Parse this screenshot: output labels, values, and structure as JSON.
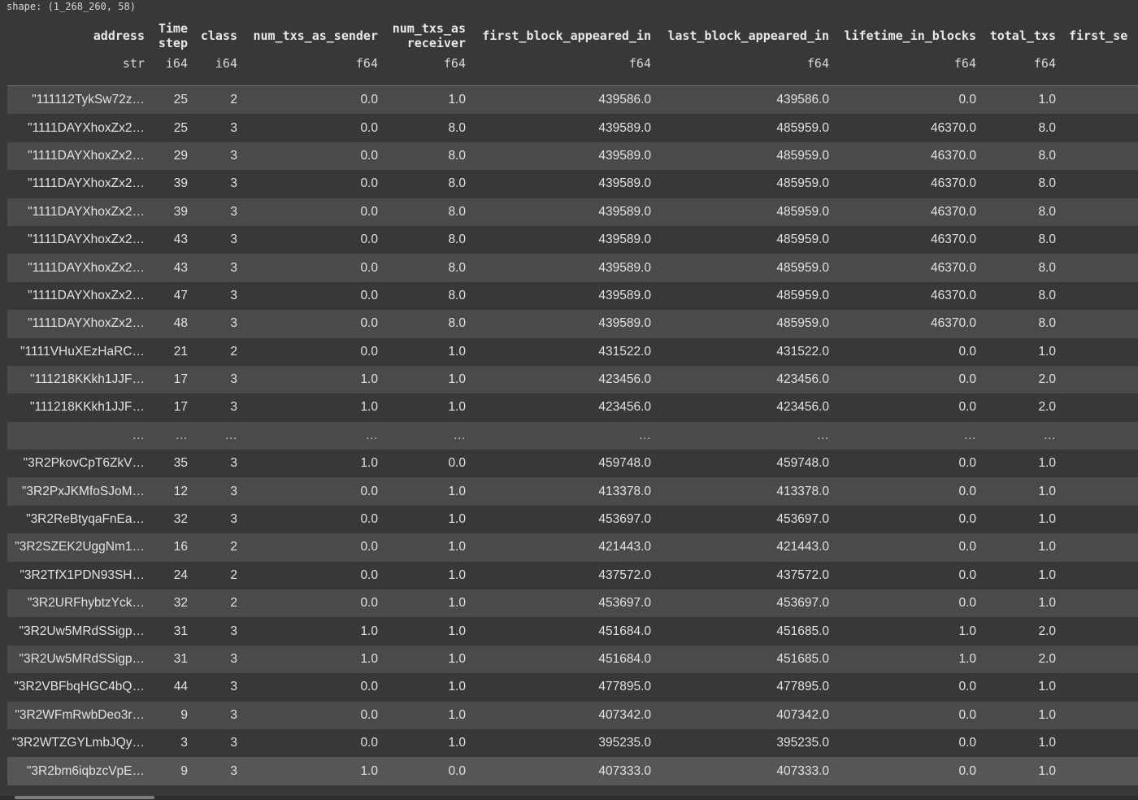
{
  "shape_label": "shape: (1_268_260, 58)",
  "columns": [
    {
      "name": "address",
      "dtype": "str"
    },
    {
      "name": "Time\nstep",
      "dtype": "i64"
    },
    {
      "name": "class",
      "dtype": "i64"
    },
    {
      "name": "num_txs_as_sender",
      "dtype": "f64"
    },
    {
      "name": "num_txs_as\nreceiver",
      "dtype": "f64"
    },
    {
      "name": "first_block_appeared_in",
      "dtype": "f64"
    },
    {
      "name": "last_block_appeared_in",
      "dtype": "f64"
    },
    {
      "name": "lifetime_in_blocks",
      "dtype": "f64"
    },
    {
      "name": "total_txs",
      "dtype": "f64"
    },
    {
      "name": "first_se",
      "dtype": ""
    }
  ],
  "rows": [
    [
      "\"111112TykSw72z…",
      "25",
      "2",
      "0.0",
      "1.0",
      "439586.0",
      "439586.0",
      "0.0",
      "1.0",
      ""
    ],
    [
      "\"1111DAYXhoxZx2…",
      "25",
      "3",
      "0.0",
      "8.0",
      "439589.0",
      "485959.0",
      "46370.0",
      "8.0",
      ""
    ],
    [
      "\"1111DAYXhoxZx2…",
      "29",
      "3",
      "0.0",
      "8.0",
      "439589.0",
      "485959.0",
      "46370.0",
      "8.0",
      ""
    ],
    [
      "\"1111DAYXhoxZx2…",
      "39",
      "3",
      "0.0",
      "8.0",
      "439589.0",
      "485959.0",
      "46370.0",
      "8.0",
      ""
    ],
    [
      "\"1111DAYXhoxZx2…",
      "39",
      "3",
      "0.0",
      "8.0",
      "439589.0",
      "485959.0",
      "46370.0",
      "8.0",
      ""
    ],
    [
      "\"1111DAYXhoxZx2…",
      "43",
      "3",
      "0.0",
      "8.0",
      "439589.0",
      "485959.0",
      "46370.0",
      "8.0",
      ""
    ],
    [
      "\"1111DAYXhoxZx2…",
      "43",
      "3",
      "0.0",
      "8.0",
      "439589.0",
      "485959.0",
      "46370.0",
      "8.0",
      ""
    ],
    [
      "\"1111DAYXhoxZx2…",
      "47",
      "3",
      "0.0",
      "8.0",
      "439589.0",
      "485959.0",
      "46370.0",
      "8.0",
      ""
    ],
    [
      "\"1111DAYXhoxZx2…",
      "48",
      "3",
      "0.0",
      "8.0",
      "439589.0",
      "485959.0",
      "46370.0",
      "8.0",
      ""
    ],
    [
      "\"1111VHuXEzHaRC…",
      "21",
      "2",
      "0.0",
      "1.0",
      "431522.0",
      "431522.0",
      "0.0",
      "1.0",
      ""
    ],
    [
      "\"111218KKkh1JJF…",
      "17",
      "3",
      "1.0",
      "1.0",
      "423456.0",
      "423456.0",
      "0.0",
      "2.0",
      ""
    ],
    [
      "\"111218KKkh1JJF…",
      "17",
      "3",
      "1.0",
      "1.0",
      "423456.0",
      "423456.0",
      "0.0",
      "2.0",
      ""
    ],
    [
      "…",
      "…",
      "…",
      "…",
      "…",
      "…",
      "…",
      "…",
      "…",
      ""
    ],
    [
      "\"3R2PkovCpT6ZkV…",
      "35",
      "3",
      "1.0",
      "0.0",
      "459748.0",
      "459748.0",
      "0.0",
      "1.0",
      ""
    ],
    [
      "\"3R2PxJKMfoSJoM…",
      "12",
      "3",
      "0.0",
      "1.0",
      "413378.0",
      "413378.0",
      "0.0",
      "1.0",
      ""
    ],
    [
      "\"3R2ReBtyqaFnEa…",
      "32",
      "3",
      "0.0",
      "1.0",
      "453697.0",
      "453697.0",
      "0.0",
      "1.0",
      ""
    ],
    [
      "\"3R2SZEK2UggNm1…",
      "16",
      "2",
      "0.0",
      "1.0",
      "421443.0",
      "421443.0",
      "0.0",
      "1.0",
      ""
    ],
    [
      "\"3R2TfX1PDN93SH…",
      "24",
      "2",
      "0.0",
      "1.0",
      "437572.0",
      "437572.0",
      "0.0",
      "1.0",
      ""
    ],
    [
      "\"3R2URFhybtzYck…",
      "32",
      "2",
      "0.0",
      "1.0",
      "453697.0",
      "453697.0",
      "0.0",
      "1.0",
      ""
    ],
    [
      "\"3R2Uw5MRdSSigp…",
      "31",
      "3",
      "1.0",
      "1.0",
      "451684.0",
      "451685.0",
      "1.0",
      "2.0",
      ""
    ],
    [
      "\"3R2Uw5MRdSSigp…",
      "31",
      "3",
      "1.0",
      "1.0",
      "451684.0",
      "451685.0",
      "1.0",
      "2.0",
      ""
    ],
    [
      "\"3R2VBFbqHGC4bQ…",
      "44",
      "3",
      "0.0",
      "1.0",
      "477895.0",
      "477895.0",
      "0.0",
      "1.0",
      ""
    ],
    [
      "\"3R2WFmRwbDeo3r…",
      "9",
      "3",
      "0.0",
      "1.0",
      "407342.0",
      "407342.0",
      "0.0",
      "1.0",
      ""
    ],
    [
      "\"3R2WTZGYLmbJQy…",
      "3",
      "3",
      "0.0",
      "1.0",
      "395235.0",
      "395235.0",
      "0.0",
      "1.0",
      ""
    ],
    [
      "\"3R2bm6iqbzcVpE…",
      "9",
      "3",
      "1.0",
      "0.0",
      "407333.0",
      "407333.0",
      "0.0",
      "1.0",
      ""
    ]
  ]
}
